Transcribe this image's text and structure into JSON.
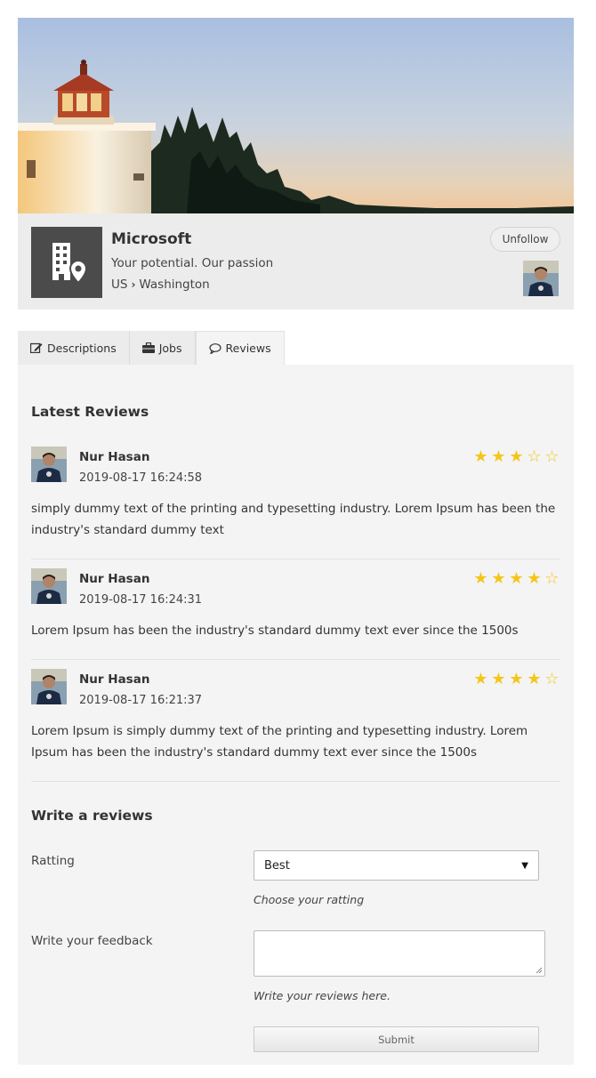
{
  "company": {
    "name": "Microsoft",
    "tagline": "Your potential. Our passion",
    "country": "US",
    "city": "Washington",
    "follow_button": "Unfollow"
  },
  "tabs": [
    {
      "label": "Descriptions",
      "icon": "edit-icon",
      "active": false
    },
    {
      "label": "Jobs",
      "icon": "briefcase-icon",
      "active": false
    },
    {
      "label": "Reviews",
      "icon": "comment-icon",
      "active": true
    }
  ],
  "reviews_section": {
    "title": "Latest Reviews",
    "items": [
      {
        "name": "Nur Hasan",
        "date": "2019-08-17 16:24:58",
        "rating": 3,
        "text": "simply dummy text of the printing and typesetting industry. Lorem Ipsum has been the industry's standard dummy text"
      },
      {
        "name": "Nur Hasan",
        "date": "2019-08-17 16:24:31",
        "rating": 4,
        "text": "Lorem Ipsum has been the industry's standard dummy text ever since the 1500s"
      },
      {
        "name": "Nur Hasan",
        "date": "2019-08-17 16:21:37",
        "rating": 4,
        "text": "Lorem Ipsum is simply dummy text of the printing and typesetting industry. Lorem Ipsum has been the industry's standard dummy text ever since the 1500s"
      }
    ]
  },
  "write_review": {
    "title": "Write a reviews",
    "rating_label": "Ratting",
    "rating_value": "Best",
    "rating_hint": "Choose your ratting",
    "feedback_label": "Write your feedback",
    "feedback_value": "",
    "feedback_hint": "Write your reviews here.",
    "submit_label": "Submit"
  },
  "colors": {
    "star": "#f5c518",
    "panel_bg": "#f4f4f4",
    "logo_bg": "#4b4b4b"
  }
}
